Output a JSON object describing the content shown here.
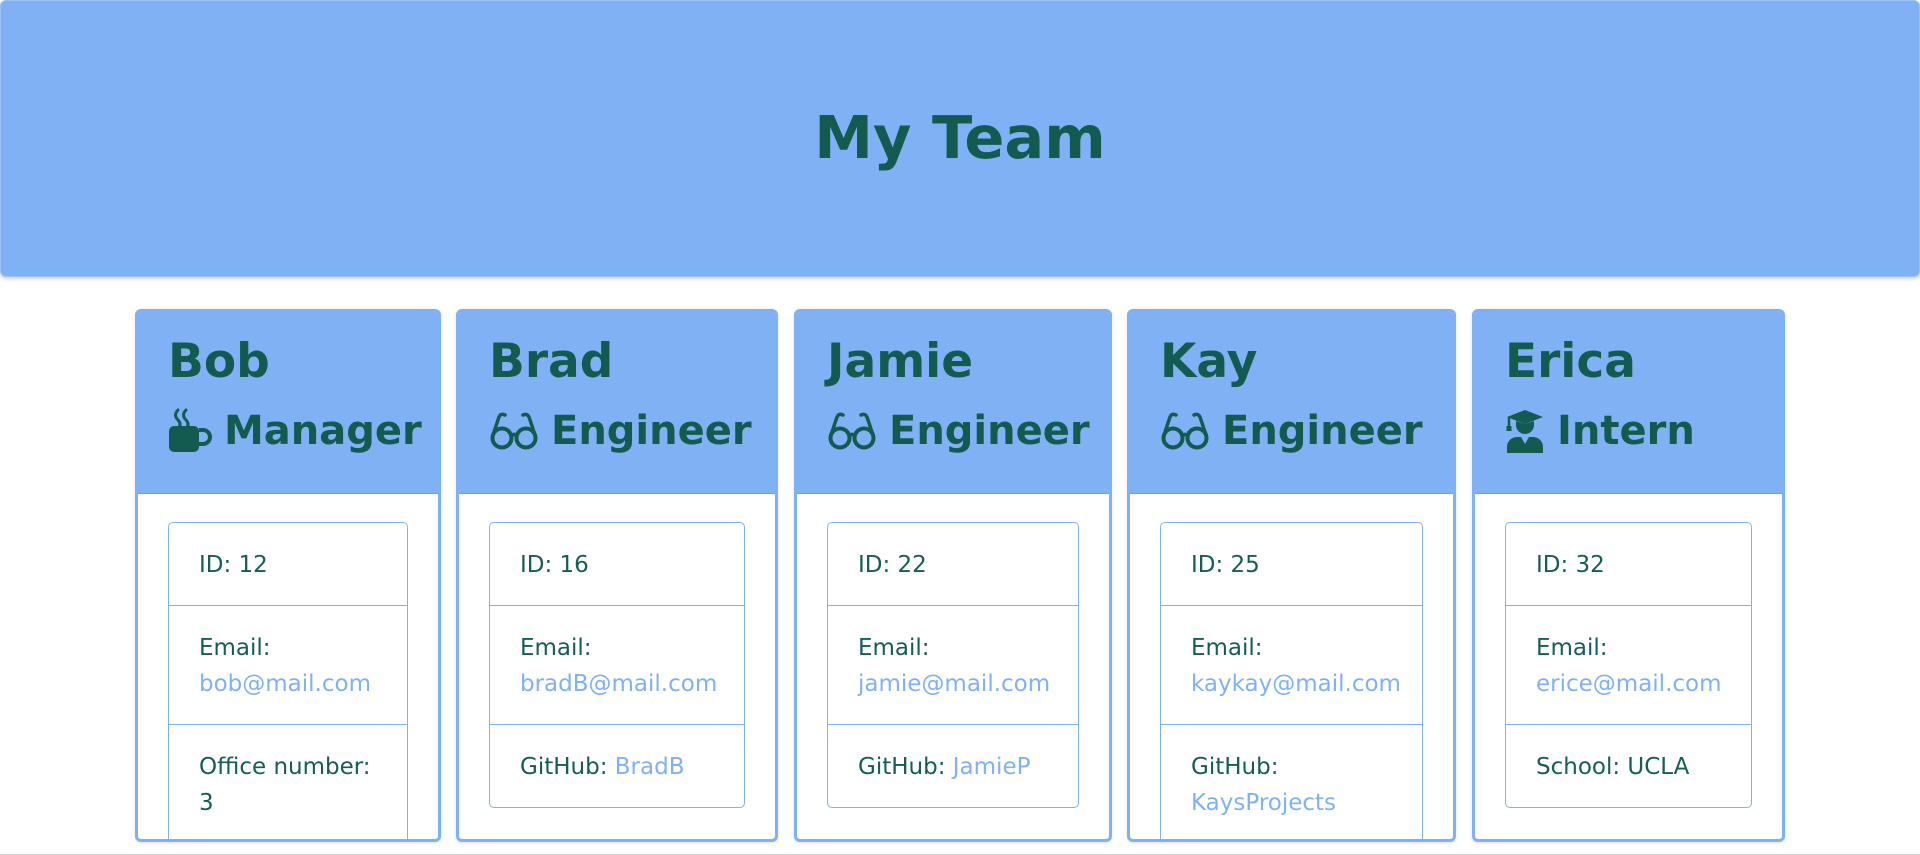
{
  "header": {
    "title": "My Team"
  },
  "employees": [
    {
      "name": "Bob",
      "role": "Manager",
      "icon": "coffee-mug-icon",
      "id_label": "ID: 12",
      "email_label": "Email:",
      "email": "bob@mail.com",
      "extra_label": "Office number: 3",
      "extra_link": ""
    },
    {
      "name": "Brad",
      "role": "Engineer",
      "icon": "glasses-icon",
      "id_label": "ID: 16",
      "email_label": "Email:",
      "email": "bradB@mail.com",
      "extra_label": "GitHub: ",
      "extra_link": "BradB"
    },
    {
      "name": "Jamie",
      "role": "Engineer",
      "icon": "glasses-icon",
      "id_label": "ID: 22",
      "email_label": "Email:",
      "email": "jamie@mail.com",
      "extra_label": "GitHub: ",
      "extra_link": "JamieP"
    },
    {
      "name": "Kay",
      "role": "Engineer",
      "icon": "glasses-icon",
      "id_label": "ID: 25",
      "email_label": "Email:",
      "email": "kaykay@mail.com",
      "extra_label": "GitHub:",
      "extra_link": "KaysProjects"
    },
    {
      "name": "Erica",
      "role": "Intern",
      "icon": "graduate-icon",
      "id_label": "ID: 32",
      "email_label": "Email:",
      "email": "erice@mail.com",
      "extra_label": "School: UCLA",
      "extra_link": ""
    }
  ],
  "colors": {
    "accent": "#7fb1f4",
    "text": "#135b50",
    "link": "#7fb1f4"
  }
}
